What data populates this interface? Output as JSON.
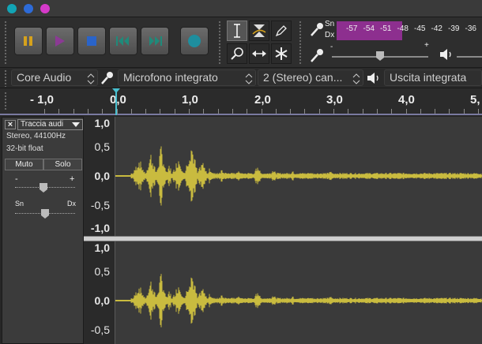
{
  "window": {
    "buttons": [
      "close",
      "minimize",
      "maximize"
    ]
  },
  "transport": {
    "pause": "pause-icon",
    "play": "play-icon",
    "stop": "stop-icon",
    "skip_start": "skip-start-icon",
    "skip_end": "skip-end-icon",
    "record": "record-icon"
  },
  "tools": [
    "selection-tool",
    "envelope-tool",
    "draw-tool",
    "zoom-tool",
    "timeshift-tool",
    "multi-tool"
  ],
  "meter": {
    "rec_left": "Sn",
    "rec_right": "Dx",
    "ticks": [
      "-57",
      "-54",
      "-51",
      "-48",
      "-45",
      "-42",
      "-39",
      "-36"
    ],
    "fill_fraction": 0.45,
    "color": "#8d2f8f"
  },
  "mixer": {
    "plus_label": "+",
    "minus_label": "-"
  },
  "devices": {
    "host": "Core Audio",
    "input": "Microfono integrato",
    "channels": "2 (Stereo) can...",
    "output": "Uscita integrata"
  },
  "ruler": {
    "labels": [
      "- 1,0",
      "0,0",
      "1,0",
      "2,0",
      "3,0",
      "4,0",
      "5,"
    ]
  },
  "track": {
    "name": "Traccia audi",
    "info_rate": "Stereo, 44100Hz",
    "info_format": "32-bit float",
    "mute": "Muto",
    "solo": "Solo",
    "gain_minus": "-",
    "gain_plus": "+",
    "pan_left": "Sn",
    "pan_right": "Dx"
  },
  "scale": {
    "ch1": [
      "1,0",
      "0,5",
      "0,0",
      "-0,5",
      "-1,0"
    ],
    "ch2": [
      "1,0",
      "0,5",
      "0,0",
      "-0,5"
    ]
  },
  "colors": {
    "waveform": "#c9bb3f",
    "meter": "#8d2f8f"
  }
}
